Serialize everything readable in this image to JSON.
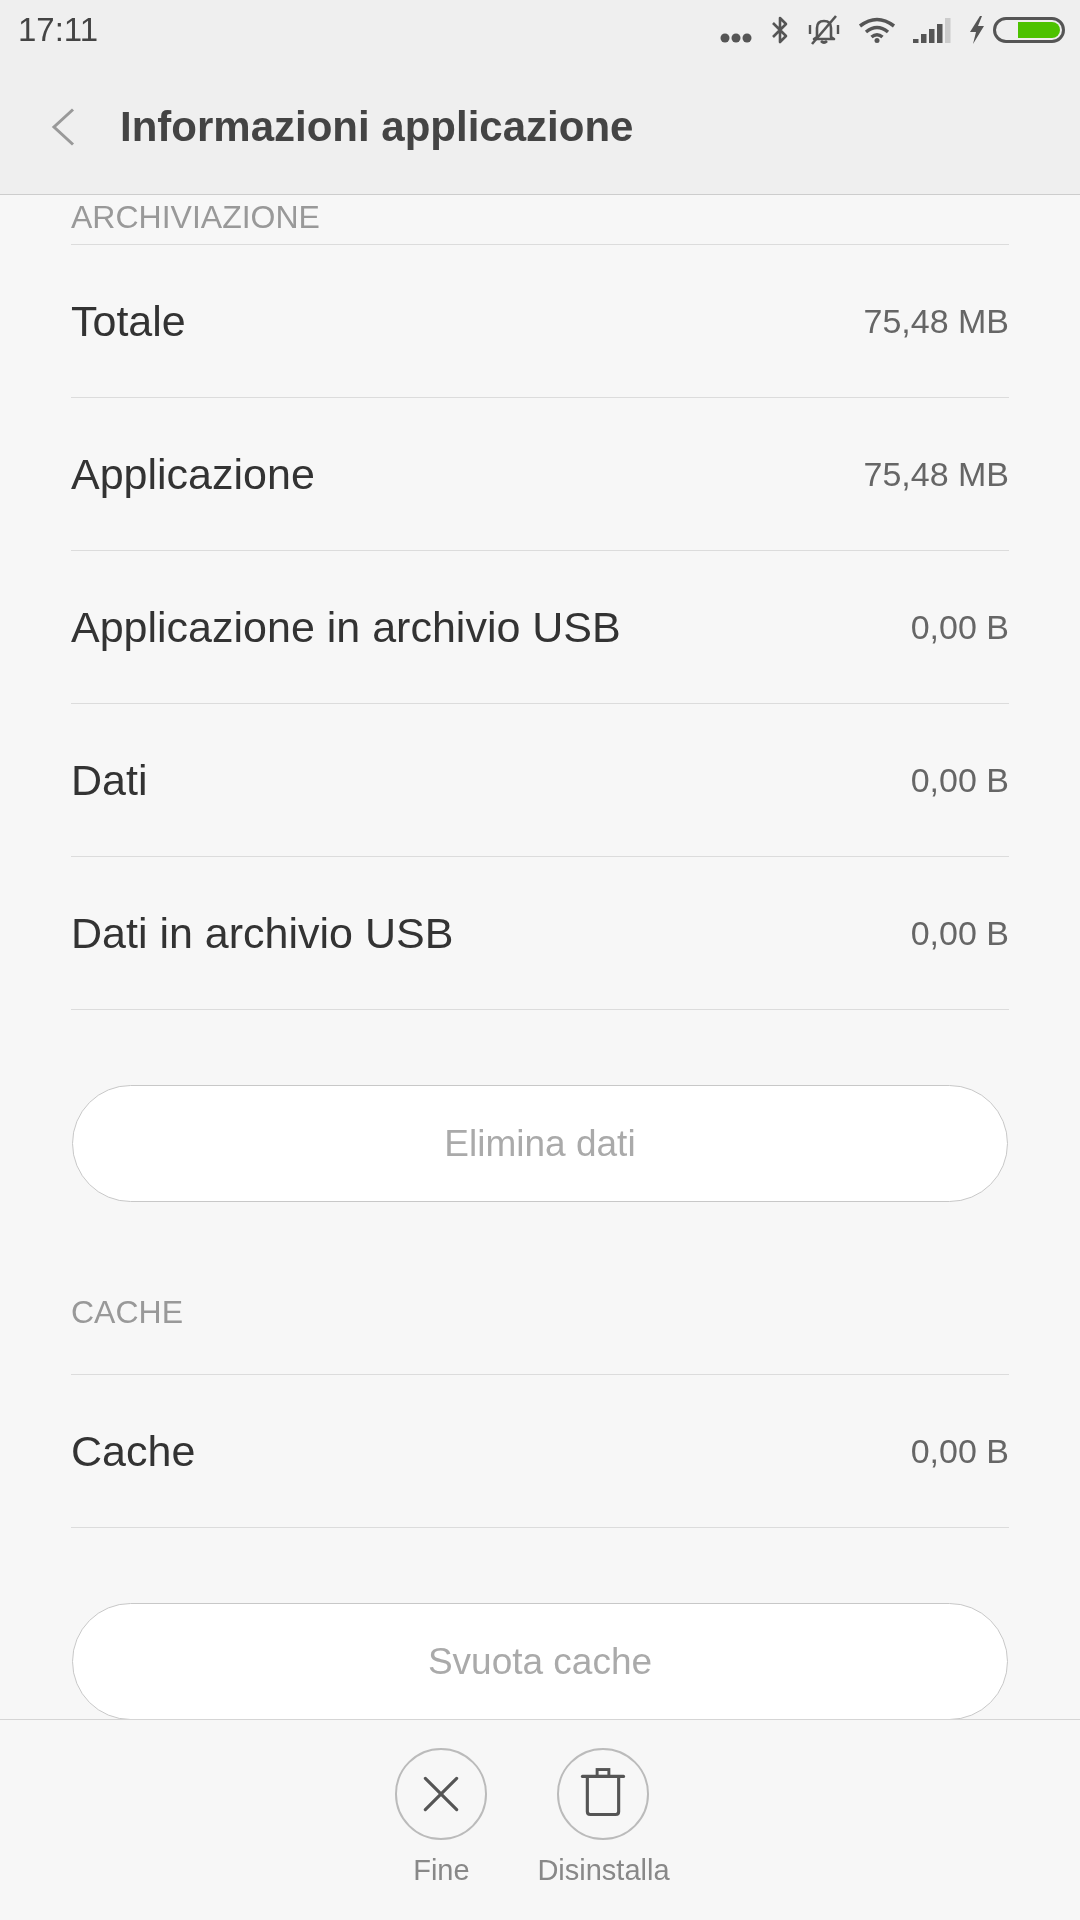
{
  "status_bar": {
    "time": "17:11"
  },
  "app_bar": {
    "title": "Informazioni applicazione"
  },
  "sections": [
    {
      "header": "ARCHIVIAZIONE",
      "rows": [
        {
          "label": "Totale",
          "value": "75,48 MB"
        },
        {
          "label": "Applicazione",
          "value": "75,48 MB"
        },
        {
          "label": "Applicazione in archivio USB",
          "value": "0,00 B"
        },
        {
          "label": "Dati",
          "value": "0,00 B"
        },
        {
          "label": "Dati in archivio USB",
          "value": "0,00 B"
        }
      ],
      "button": {
        "label": "Elimina dati",
        "disabled": true
      }
    },
    {
      "header": "CACHE",
      "rows": [
        {
          "label": "Cache",
          "value": "0,00 B"
        }
      ],
      "button": {
        "label": "Svuota cache",
        "disabled": true
      }
    }
  ],
  "bottom_bar": {
    "actions": [
      {
        "kind": "close",
        "label": "Fine"
      },
      {
        "kind": "uninstall",
        "label": "Disinstalla"
      }
    ]
  }
}
